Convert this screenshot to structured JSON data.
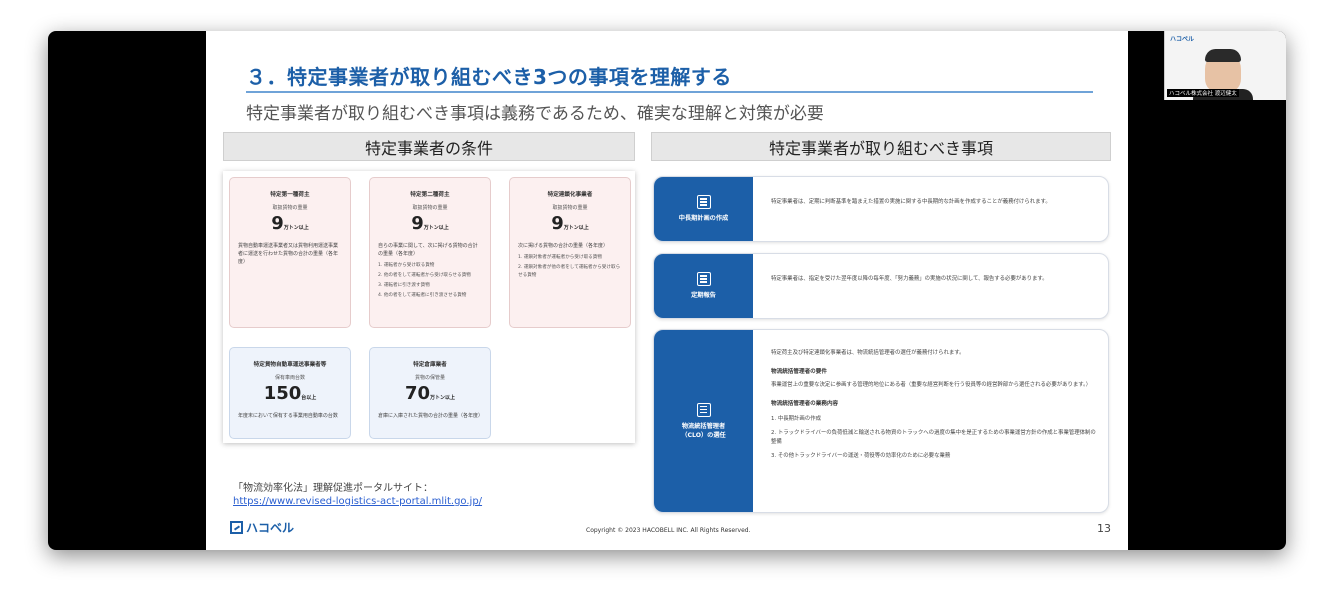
{
  "slide": {
    "title": "３．特定事業者が取り組むべき3つの事項を理解する",
    "subtitle": "特定事業者が取り組むべき事項は義務であるため、確実な理解と対策が必要",
    "left_header": "特定事業者の条件",
    "right_header": "特定事業者が取り組むべき事項",
    "cards": [
      {
        "title": "特定第一種荷主",
        "sub": "取扱貨物の重量",
        "num": "9",
        "unit": "万トン以上",
        "desc": "貨物自動車運送事業者又は貨物利用運送事業者に運送を行わせた貨物の合計の重量（各年度）",
        "list": []
      },
      {
        "title": "特定第二種荷主",
        "sub": "取扱貨物の重量",
        "num": "9",
        "unit": "万トン以上",
        "desc": "自らの事業に関して、次に掲げる貨物の合計の重量（各年度）",
        "list": [
          "1. 運転者から受け取る貨物",
          "2. 他の者をして運転者から受け取らせる貨物",
          "3. 運転者に引き渡す貨物",
          "4. 他の者をして運転者に引き渡させる貨物"
        ]
      },
      {
        "title": "特定連鎖化事業者",
        "sub": "取扱貨物の重量",
        "num": "9",
        "unit": "万トン以上",
        "desc": "次に掲げる貨物の合計の重量（各年度）",
        "list": [
          "1. 運鎖対象者が運転者から受け取る貨物",
          "2. 運鎖対象者が他の者をして運転者から受け取らせる貨物"
        ]
      },
      {
        "title": "特定貨物自動車運送事業者等",
        "sub": "保有車両台数",
        "num": "150",
        "unit": "台以上",
        "desc": "年度末において保有する事業用自動車の台数",
        "list": []
      },
      {
        "title": "特定倉庫業者",
        "sub": "貨物の保管量",
        "num": "70",
        "unit": "万トン以上",
        "desc": "倉庫に入庫された貨物の合計の重量（各年度）",
        "list": []
      }
    ],
    "rows": [
      {
        "label": "中長期計画の作成",
        "text": "特定事業者は、定期に判断基準を踏まえた措置の実施に関する中長期的な計画を作成することが義務付けられます。"
      },
      {
        "label": "定期報告",
        "text": "特定事業者は、指定を受けた翌年度以降の毎年度、「努力義務」の実施の状況に関して、報告する必要があります。"
      },
      {
        "label1": "物流統括管理者",
        "label2": "（CLO）の選任",
        "intro": "特定荷主及び特定連鎖化事業者は、物流統括管理者の選任が義務付けられます。",
        "req_head": "物流統括管理者の要件",
        "req_text": "事業運営上の重要な決定に参画する管理的地位にある者（重要な経営判断を行う役員等の経営幹部から選任される必要があります。）",
        "duty_head": "物流統括管理者の業務内容",
        "duties": [
          "1. 中長期計画の作成",
          "2. トラックドライバーの負荷低減と輸送される物資のトラックへの過度の集中を是正するための事業運営方針の作成と事業管理体制の整備",
          "3. その他トラックドライバーの運送・荷役等の効率化のために必要な業務"
        ]
      }
    ],
    "footnote_line1": "「物流効率化法」理解促進ポータルサイト：",
    "footnote_link": "https://www.revised-logistics-act-portal.mlit.go.jp/",
    "logo": "ハコベル",
    "copyright": "Copyright © 2023 HACOBELL INC. All Rights Reserved.",
    "page_number": "13"
  },
  "camera": {
    "brand": "ハコベル",
    "name_tag": "ハコベル株式会社 渡辺健太"
  },
  "colors": {
    "accent_blue": "#1c5fa8",
    "card_pink": "#fcf0f0",
    "card_blue": "#eef3fb"
  }
}
